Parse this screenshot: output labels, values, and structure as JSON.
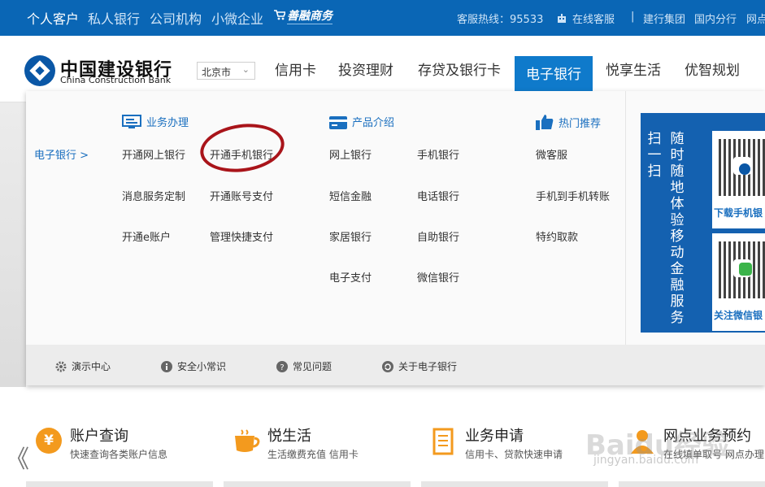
{
  "topbar": {
    "segments": [
      "个人客户",
      "私人银行",
      "公司机构",
      "小微企业"
    ],
    "shanrong": "善融商务",
    "hotline": "客服热线：95533",
    "online_service": "在线客服",
    "divider": "|",
    "jianshe_group": "建行集团",
    "domestic_branch": "国内分行",
    "outlet": "网点"
  },
  "header": {
    "logo_cn": "中国建设银行",
    "logo_en": "China Construction Bank",
    "city": "北京市",
    "nav": [
      "信用卡",
      "投资理财",
      "存贷及银行卡",
      "电子银行",
      "悦享生活",
      "优智规划"
    ]
  },
  "dropdown": {
    "breadcrumb": "电子银行 >",
    "sections": {
      "business": {
        "title": "业务办理",
        "links": [
          "开通网上银行",
          "开通手机银行",
          "消息服务定制",
          "开通账号支付",
          "开通e账户",
          "管理快捷支付"
        ]
      },
      "products": {
        "title": "产品介绍",
        "links": [
          "网上银行",
          "手机银行",
          "短信金融",
          "电话银行",
          "家居银行",
          "自助银行",
          "电子支付",
          "微信银行"
        ]
      },
      "hot": {
        "title": "热门推荐",
        "links": [
          "微客服",
          "手机到手机转账",
          "特约取款"
        ]
      }
    },
    "qr": {
      "text1": "扫一扫",
      "text2": "随时随地体验移动金融服务",
      "cap1": "下载手机银",
      "cap2": "关注微信银"
    },
    "footer": [
      "演示中心",
      "安全小常识",
      "常见问题",
      "关于电子银行"
    ]
  },
  "services": [
    {
      "icon": "¥",
      "title": "账户查询",
      "desc": "快速查询各类账户信息"
    },
    {
      "icon": "",
      "title": "悦生活",
      "desc": "生活缴费充值 信用卡"
    },
    {
      "icon": "",
      "title": "业务申请",
      "desc": "信用卡、贷款快速申请"
    },
    {
      "icon": "",
      "title": "网点业务预约",
      "desc": "在线填单取号 网点办理"
    }
  ],
  "nav_arrow": "《",
  "watermark": "Baidu经验",
  "watermark_url": "jingyan.baidu.com",
  "colors": {
    "primary": "#0a66b5",
    "accent": "#f39a1e",
    "circle": "#a9141a"
  }
}
